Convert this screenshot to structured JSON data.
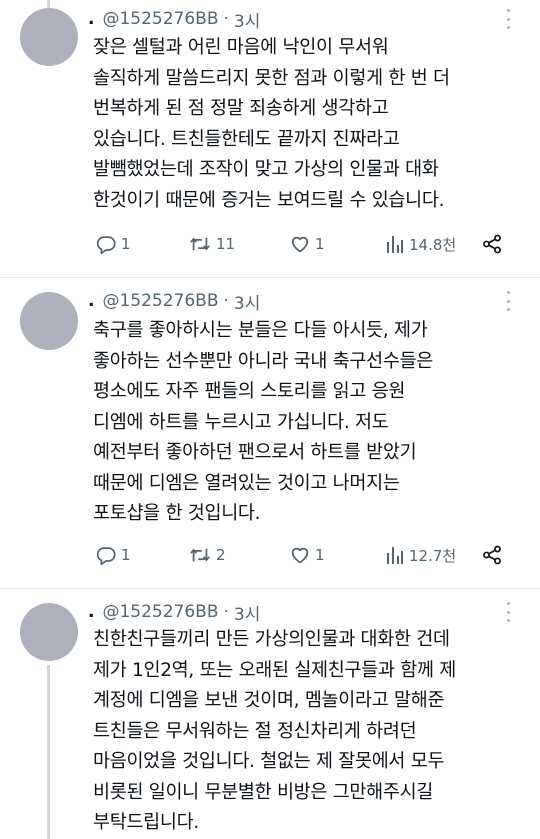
{
  "tweets": [
    {
      "handle": "@1525276BB",
      "time": "3시",
      "lines": [
        "잦은 셀털과 어린 마음에 낙인이 무서워",
        "솔직하게 말씀드리지 못한 점과 이렇게 한 번 더",
        "번복하게 된 점 정말 죄송하게 생각하고",
        "있습니다. 트친들한테도 끝까지 진짜라고",
        "발뺌했었는데 조작이 맞고 가상의 인물과 대화",
        "한것이기 때문에 증거는 보여드릴 수 있습니다."
      ],
      "replies": "1",
      "retweets": "11",
      "likes": "1",
      "views": "14.8천"
    },
    {
      "handle": "@1525276BB",
      "time": "3시",
      "lines": [
        "축구를 좋아하시는 분들은 다들 아시듯, 제가",
        "좋아하는 선수뿐만 아니라 국내 축구선수들은",
        "평소에도 자주 팬들의 스토리를 읽고 응원",
        "디엠에 하트를 누르시고 가십니다. 저도",
        "예전부터 좋아하던 팬으로서 하트를 받았기",
        "때문에 디엠은 열려있는 것이고 나머지는",
        "포토샵을 한 것입니다."
      ],
      "replies": "1",
      "retweets": "2",
      "likes": "1",
      "views": "12.7천"
    },
    {
      "handle": "@1525276BB",
      "time": "3시",
      "lines": [
        "친한친구들끼리 만든 가상의인물과 대화한 건데",
        "제가 1인2역, 또는 오래된 실제친구들과 함께 제",
        "계정에 디엠을 보낸 것이며, 멤놀이라고 말해준",
        "트친들은 무서워하는 절 정신차리게 하려던",
        "마음이었을 것입니다. 철없는 제 잘못에서 모두",
        "비롯된 일이니 무분별한 비방은 그만해주시길",
        "부탁드립니다."
      ]
    }
  ],
  "dot_prefix": ".",
  "separator": "·",
  "colors": {
    "text": "#0f1419",
    "secondary": "#536471",
    "avatar": "#aeb1bb",
    "thread_line": "#cfd5da",
    "divider": "#e3e7ea"
  }
}
